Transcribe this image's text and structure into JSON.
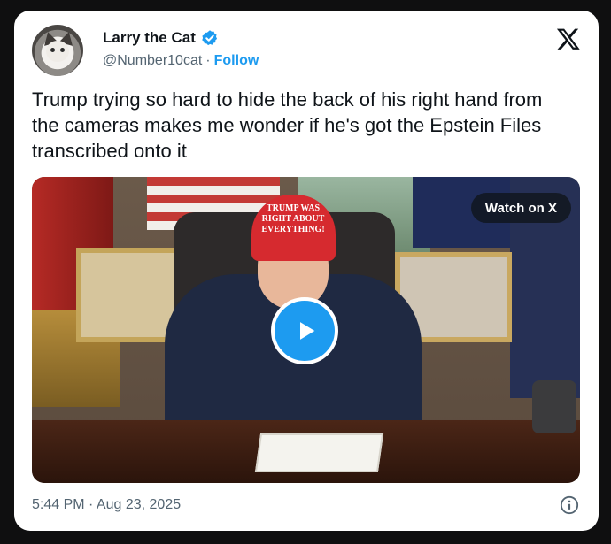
{
  "author": {
    "name": "Larry the Cat",
    "handle": "@Number10cat",
    "separator": "·",
    "follow_label": "Follow"
  },
  "tweet": {
    "text": "Trump trying so hard to hide the back of his right hand from the cameras makes me wonder if he's got the Epstein Files transcribed onto it"
  },
  "media": {
    "watch_label": "Watch on X",
    "hat_text": "TRUMP WAS RIGHT ABOUT EVERYTHING!"
  },
  "footer": {
    "timestamp": "5:44 PM · Aug 23, 2025"
  },
  "icons": {
    "verified": "verified-badge-icon",
    "brand": "x-logo-icon",
    "play": "play-icon",
    "info": "info-icon"
  },
  "colors": {
    "accent": "#1d9bf0",
    "text": "#0f1419",
    "secondary": "#536471",
    "background": "#0f0f10",
    "card": "#ffffff"
  }
}
